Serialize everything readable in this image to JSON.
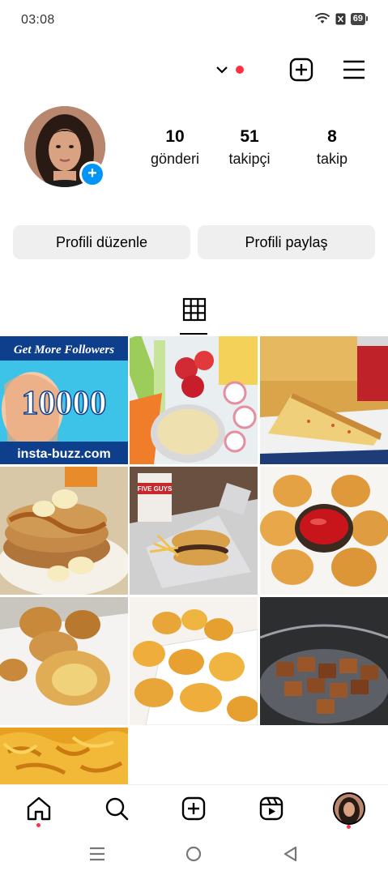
{
  "status_bar": {
    "time": "03:08",
    "battery": "69",
    "icons": [
      "wifi-icon",
      "no-sim-icon",
      "battery-icon"
    ]
  },
  "top_bar": {
    "icons": [
      "chevron-down-icon",
      "notification-dot",
      "create-plus-icon",
      "menu-icon"
    ]
  },
  "profile": {
    "stats": [
      {
        "value": "10",
        "label": "gönderi"
      },
      {
        "value": "51",
        "label": "takipçi"
      },
      {
        "value": "8",
        "label": "takip"
      }
    ],
    "add_story_glyph": "+"
  },
  "actions": {
    "edit_label": "Profili düzenle",
    "share_label": "Profili paylaş"
  },
  "posts": {
    "ad": {
      "line1": "Get More Followers",
      "line2": "10000",
      "line3": "insta-buzz.com"
    },
    "five_guys_cup": "FIVE GUYS",
    "descriptions": [
      "followers-ad",
      "vegetables-hummus",
      "pizza-slice",
      "pancakes-banana",
      "burger-fries",
      "nuggets-ketchup",
      "fried-balls",
      "chicken-nuggets",
      "caramel-cubes",
      "mac-and-cheese"
    ]
  },
  "bottom_nav": {
    "items": [
      "home-icon",
      "search-icon",
      "create-icon",
      "reels-icon",
      "profile-avatar"
    ]
  },
  "colors": {
    "accent_blue": "#0095f6",
    "notification_red": "#ff3040",
    "button_gray": "#efefef"
  }
}
